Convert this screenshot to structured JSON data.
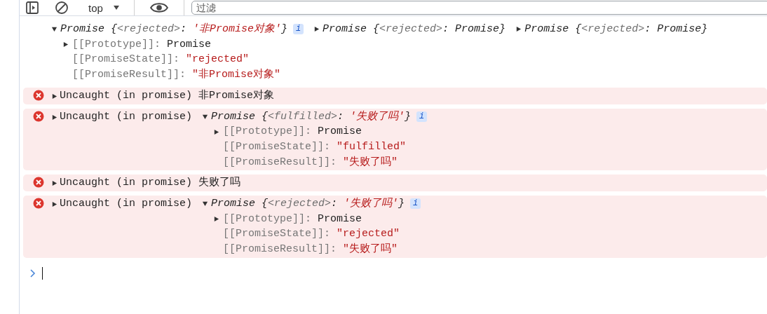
{
  "toolbar": {
    "context": "top",
    "filter_placeholder": "过滤"
  },
  "entries": [
    {
      "kind": "log",
      "objects": [
        {
          "expanded": true,
          "badge": "i",
          "preview": [
            {
              "text": "Promise {",
              "kind": "plain"
            },
            {
              "text": "<rejected>",
              "kind": "meta"
            },
            {
              "text": ": ",
              "kind": "plain"
            },
            {
              "text": "'非Promise对象'",
              "kind": "string"
            },
            {
              "text": "}",
              "kind": "plain"
            }
          ],
          "properties": [
            {
              "key": "[[Prototype]]:",
              "value": "Promise",
              "kind": "object"
            },
            {
              "key": "[[PromiseState]]:",
              "value": "\"rejected\"",
              "kind": "string"
            },
            {
              "key": "[[PromiseResult]]:",
              "value": "\"非Promise对象\"",
              "kind": "string"
            }
          ]
        },
        {
          "expanded": false,
          "preview": [
            {
              "text": "Promise {",
              "kind": "plain"
            },
            {
              "text": "<rejected>",
              "kind": "meta"
            },
            {
              "text": ": Promise}",
              "kind": "plain"
            }
          ]
        },
        {
          "expanded": false,
          "preview": [
            {
              "text": "Promise {",
              "kind": "plain"
            },
            {
              "text": "<rejected>",
              "kind": "meta"
            },
            {
              "text": ": Promise}",
              "kind": "plain"
            }
          ]
        }
      ]
    },
    {
      "kind": "error",
      "prefix": "Uncaught (in promise)",
      "message": "非Promise对象"
    },
    {
      "kind": "error",
      "prefix": "Uncaught (in promise)",
      "objects": [
        {
          "expanded": true,
          "badge": "i",
          "preview": [
            {
              "text": "Promise {",
              "kind": "plain"
            },
            {
              "text": "<fulfilled>",
              "kind": "meta"
            },
            {
              "text": ": ",
              "kind": "plain"
            },
            {
              "text": "'失败了吗'",
              "kind": "string"
            },
            {
              "text": "}",
              "kind": "plain"
            }
          ],
          "properties": [
            {
              "key": "[[Prototype]]:",
              "value": "Promise",
              "kind": "object"
            },
            {
              "key": "[[PromiseState]]:",
              "value": "\"fulfilled\"",
              "kind": "string"
            },
            {
              "key": "[[PromiseResult]]:",
              "value": "\"失败了吗\"",
              "kind": "string"
            }
          ]
        }
      ]
    },
    {
      "kind": "error",
      "prefix": "Uncaught (in promise)",
      "message": "失败了吗"
    },
    {
      "kind": "error",
      "prefix": "Uncaught (in promise)",
      "objects": [
        {
          "expanded": true,
          "badge": "i",
          "preview": [
            {
              "text": "Promise {",
              "kind": "plain"
            },
            {
              "text": "<rejected>",
              "kind": "meta"
            },
            {
              "text": ": ",
              "kind": "plain"
            },
            {
              "text": "'失败了吗'",
              "kind": "string"
            },
            {
              "text": "}",
              "kind": "plain"
            }
          ],
          "properties": [
            {
              "key": "[[Prototype]]:",
              "value": "Promise",
              "kind": "object"
            },
            {
              "key": "[[PromiseState]]:",
              "value": "\"rejected\"",
              "kind": "string"
            },
            {
              "key": "[[PromiseResult]]:",
              "value": "\"失败了吗\"",
              "kind": "string"
            }
          ]
        }
      ]
    }
  ]
}
